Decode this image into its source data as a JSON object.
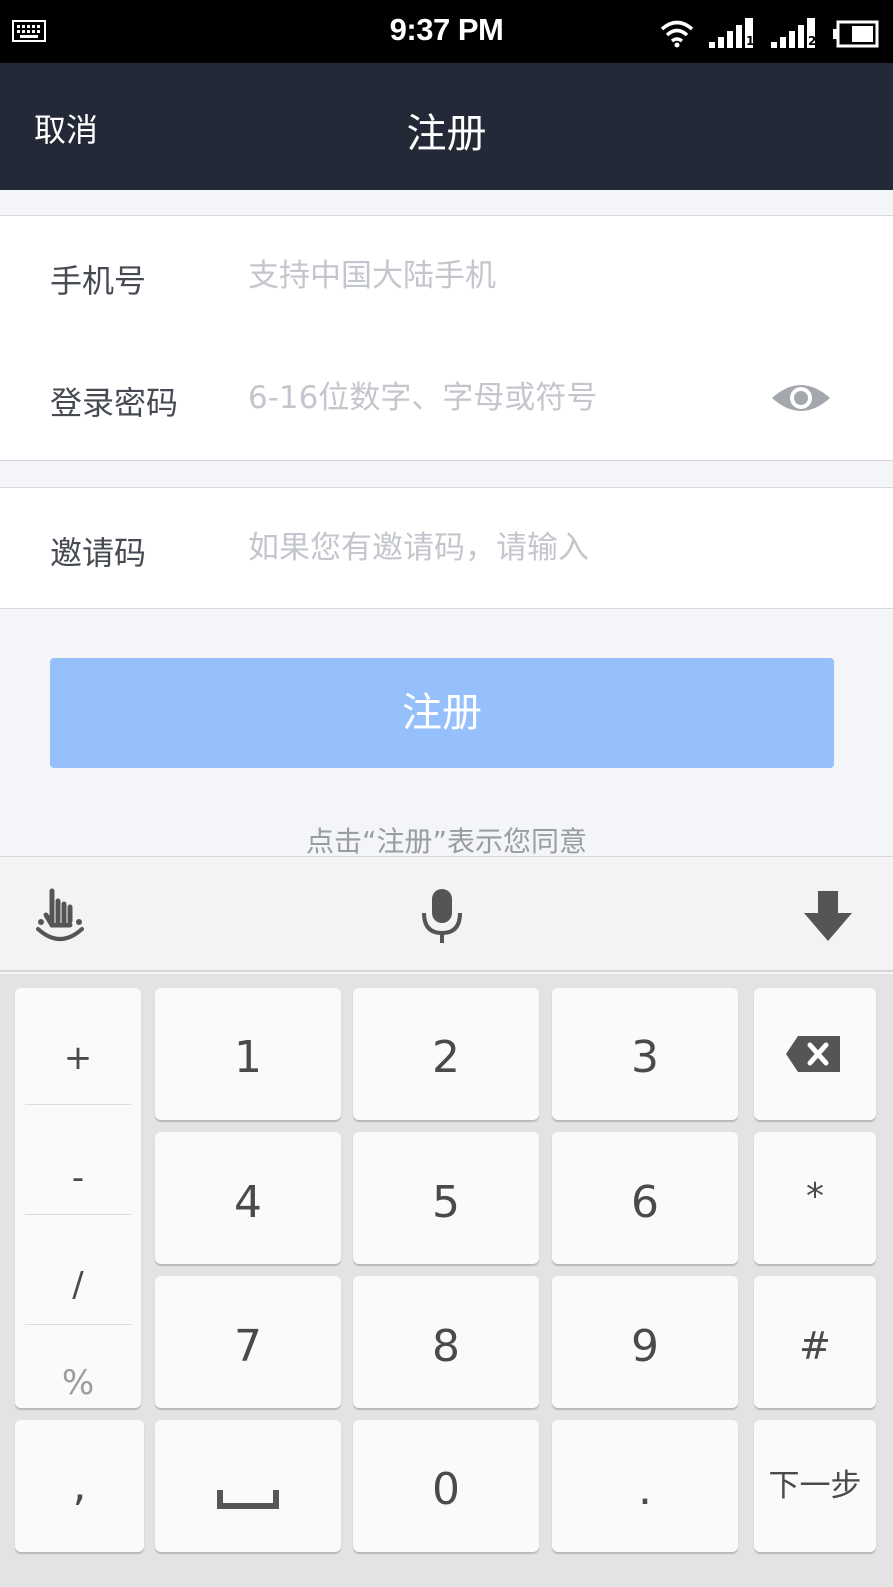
{
  "status_bar": {
    "time": "9:37 PM",
    "icons": [
      "keyboard-icon",
      "wifi-icon",
      "signal-sim1-icon",
      "signal-sim2-icon",
      "battery-icon"
    ]
  },
  "nav": {
    "cancel_label": "取消",
    "title": "注册"
  },
  "form": {
    "phone": {
      "label": "手机号",
      "placeholder": "支持中国大陆手机"
    },
    "password": {
      "label": "登录密码",
      "placeholder": "6-16位数字、字母或符号"
    },
    "invite": {
      "label": "邀请码",
      "placeholder": "如果您有邀请码，请输入"
    }
  },
  "register_button_label": "注册",
  "agreement_text": "点击“注册”表示您同意",
  "keyboard": {
    "toolbar_icons": [
      "handwriting-icon",
      "microphone-icon",
      "hide-keyboard-icon"
    ],
    "side_keys": [
      "+",
      "-",
      "/",
      "%"
    ],
    "keys": {
      "k1": "1",
      "k2": "2",
      "k3": "3",
      "k4": "4",
      "k5": "5",
      "k6": "6",
      "k7": "7",
      "k8": "8",
      "k9": "9",
      "k0": "0",
      "star": "*",
      "hash": "#",
      "comma": ",",
      "dot": ".",
      "next": "下一步"
    }
  },
  "colors": {
    "nav_bg": "#232936",
    "register_button": "#95c0fb",
    "page_bg": "#f4f5f9"
  }
}
